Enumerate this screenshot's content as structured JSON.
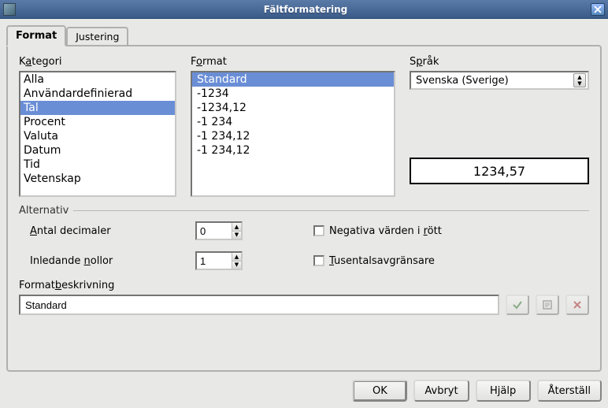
{
  "window": {
    "title": "Fältformatering"
  },
  "tabs": [
    {
      "label": "Format",
      "active": true
    },
    {
      "label": "Justering",
      "active": false
    }
  ],
  "labels": {
    "kategori_pre": "K",
    "kategori_ul": "a",
    "kategori_post": "tegori",
    "format_pre": "F",
    "format_ul": "o",
    "format_post": "rmat",
    "sprak_pre": "S",
    "sprak_ul": "p",
    "sprak_post": "råk",
    "alternativ": "Alternativ",
    "antal_pre": "",
    "antal_ul": "A",
    "antal_post": "ntal decimaler",
    "inledande_pre": "Inledande ",
    "inledande_ul": "n",
    "inledande_post": "ollor",
    "neg_pre": "Negativa värden i ",
    "neg_ul": "r",
    "neg_post": "ött",
    "tusen_pre": "",
    "tusen_ul": "T",
    "tusen_post": "usentalsavgränsare",
    "formatbesk_pre": "Format",
    "formatbesk_ul": "b",
    "formatbesk_post": "eskrivning"
  },
  "category": {
    "items": [
      "Alla",
      "Användardefinierad",
      "Tal",
      "Procent",
      "Valuta",
      "Datum",
      "Tid",
      "Vetenskap"
    ],
    "selected_index": 2
  },
  "formats": {
    "items": [
      "Standard",
      "-1234",
      "-1234,12",
      "-1 234",
      "-1 234,12",
      "-1 234,12"
    ],
    "selected_index": 0
  },
  "language": {
    "value": "Svenska (Sverige)"
  },
  "preview": "1234,57",
  "options": {
    "decimals": "0",
    "leading_zeros": "1",
    "neg_red": false,
    "thousand_sep": false
  },
  "format_code": "Standard",
  "buttons": {
    "ok": "OK",
    "cancel": "Avbryt",
    "help": "Hjälp",
    "reset": "Återställ"
  },
  "icons": {
    "close": "close-icon",
    "apply_code": "check-icon",
    "note_code": "note-icon",
    "remove_code": "x-icon"
  }
}
